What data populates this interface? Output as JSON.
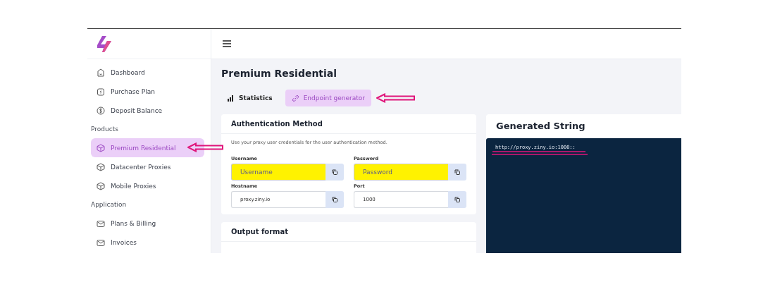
{
  "sidebar": {
    "items": [
      {
        "kind": "item",
        "label": "Dashboard",
        "selected": false
      },
      {
        "kind": "item",
        "label": "Purchase Plan",
        "selected": false
      },
      {
        "kind": "item",
        "label": "Deposit Balance",
        "selected": false
      },
      {
        "kind": "section",
        "label": "Products"
      },
      {
        "kind": "item",
        "label": "Premium Residential",
        "selected": true
      },
      {
        "kind": "item",
        "label": "Datacenter Proxies",
        "selected": false
      },
      {
        "kind": "item",
        "label": "Mobile Proxies",
        "selected": false
      },
      {
        "kind": "section",
        "label": "Application"
      },
      {
        "kind": "item",
        "label": "Plans & Billing",
        "selected": false
      },
      {
        "kind": "item",
        "label": "Invoices",
        "selected": false
      }
    ]
  },
  "page": {
    "title": "Premium Residential"
  },
  "tabs": [
    {
      "label": "Statistics",
      "selected": false
    },
    {
      "label": "Endpoint generator",
      "selected": true
    }
  ],
  "auth_card": {
    "title": "Authentication Method",
    "description": "Use your proxy user credentials for the user authentication method.",
    "fields": [
      {
        "label": "Username",
        "placeholder": "Username",
        "highlighted": true
      },
      {
        "label": "Password",
        "placeholder": "Password",
        "highlighted": true
      },
      {
        "label": "Hostname",
        "value": "proxy.ziny.io",
        "highlighted": false
      },
      {
        "label": "Port",
        "value": "1000",
        "highlighted": false
      }
    ]
  },
  "output_card": {
    "title": "Output format"
  },
  "generated_card": {
    "title": "Generated String",
    "output": "http://proxy.ziny.io:1000::"
  }
}
